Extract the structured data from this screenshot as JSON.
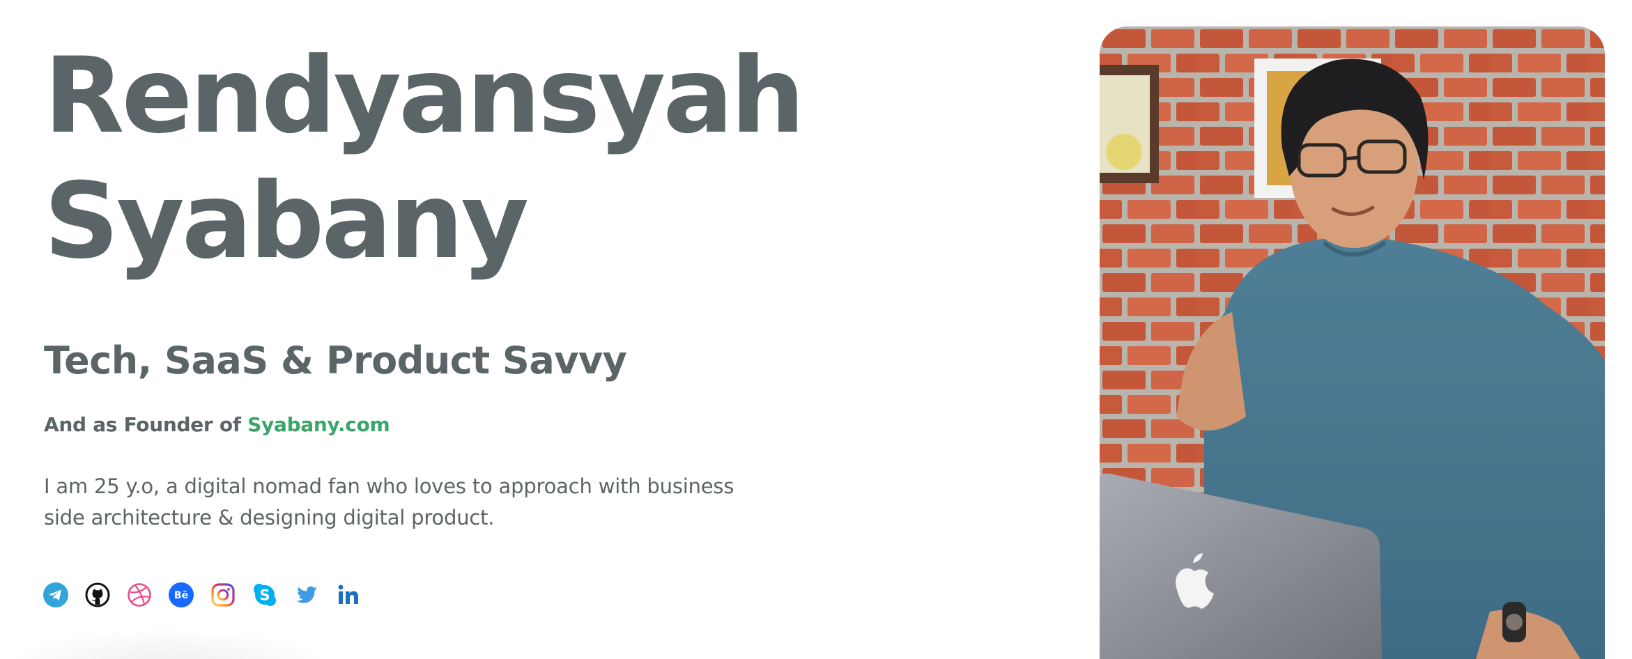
{
  "hero": {
    "name_line1": "Rendyansyah",
    "name_line2": "Syabany",
    "tagline": "Tech, SaaS & Product Savvy",
    "founder_prefix": "And as Founder of",
    "founder_link": "Syabany.com",
    "bio": "I am 25 y.o, a digital nomad fan who loves to approach with business side architecture & designing digital product."
  },
  "socials": [
    {
      "name": "telegram-icon",
      "color": "#2fa5da"
    },
    {
      "name": "github-icon",
      "color": "#111111"
    },
    {
      "name": "dribbble-icon",
      "color": "#ea4c89"
    },
    {
      "name": "behance-icon",
      "color": "#1769ff"
    },
    {
      "name": "instagram-icon",
      "color": "#c13584"
    },
    {
      "name": "skype-icon",
      "color": "#00aff0"
    },
    {
      "name": "twitter-icon",
      "color": "#1da1f2"
    },
    {
      "name": "linkedin-icon",
      "color": "#0a66c2"
    }
  ],
  "colors": {
    "text": "#5b6467",
    "accent": "#3aa56a"
  }
}
